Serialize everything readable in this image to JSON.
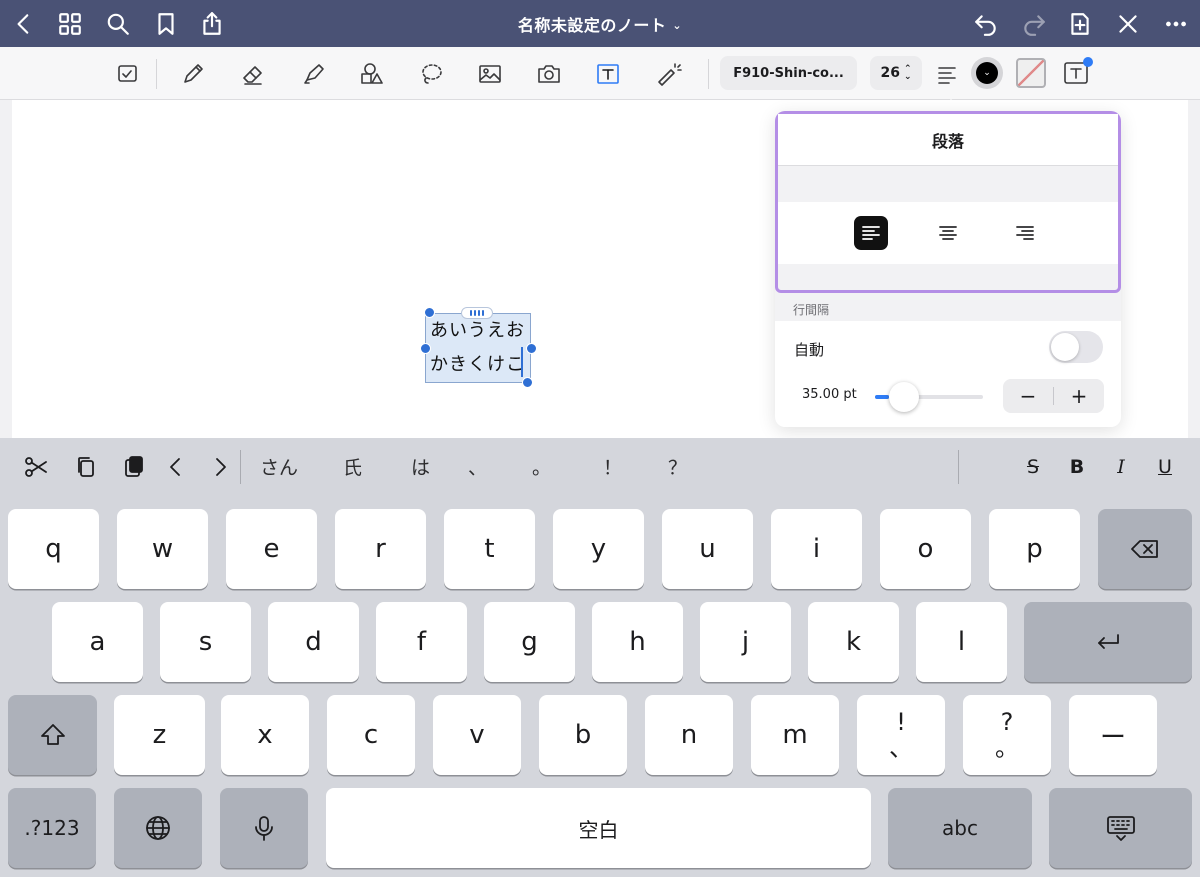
{
  "header": {
    "title": "名称未設定のノート"
  },
  "toolbar": {
    "font_name": "F910-Shin-co...",
    "font_size": "26"
  },
  "canvas": {
    "text_lines": [
      "あいうえお",
      "かきくけこ"
    ]
  },
  "paragraph_panel": {
    "title": "段落",
    "alignment_options": [
      "left",
      "center",
      "right"
    ],
    "selected_alignment": "left",
    "line_spacing_label": "行間隔",
    "auto_label": "自動",
    "auto_enabled": false,
    "value_label": "35.00 pt",
    "stepper_minus": "−",
    "stepper_plus": "+"
  },
  "shortcut_bar": {
    "candidates": [
      "さん",
      "氏",
      "は",
      "、",
      "。",
      "！",
      "？"
    ],
    "format_buttons": [
      "S",
      "B",
      "I",
      "U"
    ]
  },
  "keyboard": {
    "row1": [
      "q",
      "w",
      "e",
      "r",
      "t",
      "y",
      "u",
      "i",
      "o",
      "p"
    ],
    "row2": [
      "a",
      "s",
      "d",
      "f",
      "g",
      "h",
      "j",
      "k",
      "l"
    ],
    "row3": [
      "z",
      "x",
      "c",
      "v",
      "b",
      "n",
      "m"
    ],
    "row3_punct": [
      [
        "!",
        "、"
      ],
      [
        "?",
        "。"
      ]
    ],
    "row3_dash": "ー",
    "numbers_key": ".?123",
    "space_key": "空白",
    "abc_key": "abc"
  },
  "colors": {
    "titlebar": "#4a5275",
    "accent": "#2f7cf6",
    "panel_highlight": "#b48ee6",
    "selection": "#dce8f7"
  }
}
